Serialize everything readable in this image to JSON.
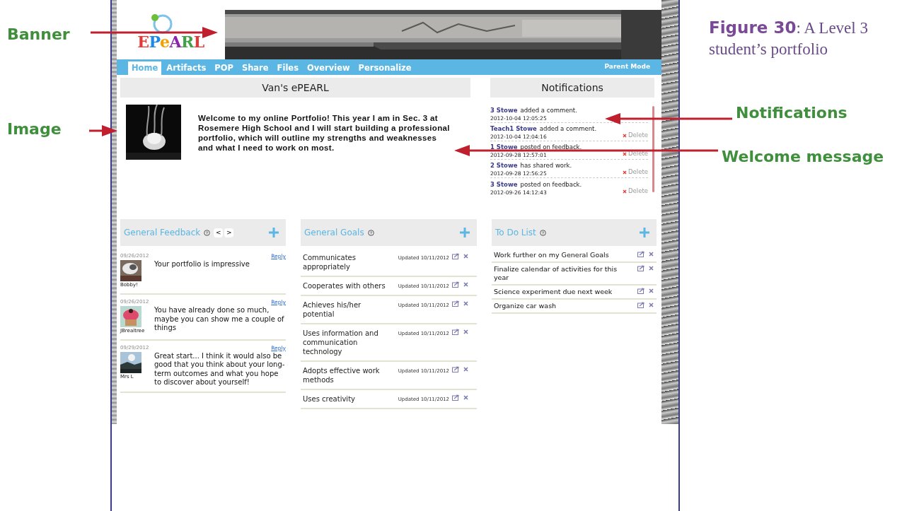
{
  "annotations": [
    {
      "label": "Banner"
    },
    {
      "label": "Image"
    },
    {
      "label": "Notifications"
    },
    {
      "label": "Welcome message"
    }
  ],
  "caption": {
    "figure": "Figure 30",
    "text": ": A Level 3 student’s portfolio"
  },
  "logo": {
    "text": "EPeARL"
  },
  "nav": {
    "tabs": [
      {
        "label": "Home",
        "selected": true
      },
      {
        "label": "Artifacts",
        "selected": false
      },
      {
        "label": "POP",
        "selected": false
      },
      {
        "label": "Share",
        "selected": false
      },
      {
        "label": "Files",
        "selected": false
      },
      {
        "label": "Overview",
        "selected": false
      },
      {
        "label": "Personalize",
        "selected": false
      }
    ],
    "parent_mode": "Parent Mode"
  },
  "welcome": {
    "title": "Van's ePEARL",
    "message": "Welcome to my online Portfolio! This year I am in Sec. 3 at Rosemere High School and I will start building a professional portfolio, which will outline my strengths and weaknesses and what I need to work on most."
  },
  "notifications": {
    "title": "Notifications",
    "items": [
      {
        "user": "3 Stowe",
        "action": "added a comment.",
        "time": "2012-10-04 12:05:25"
      },
      {
        "user": "Teach1 Stowe",
        "action": "added a comment.",
        "time": "2012-10-04 12:04:16",
        "delete": "Delete"
      },
      {
        "user": "1 Stowe",
        "action": "posted on feedback.",
        "time": "2012-09-28 12:57:01",
        "delete": "Delete"
      },
      {
        "user": "2 Stowe",
        "action": "has shared work.",
        "time": "2012-09-28 12:56:25",
        "delete": "Delete"
      },
      {
        "user": "3 Stowe",
        "action": "posted on feedback.",
        "time": "2012-09-26 14:12:43",
        "delete": "Delete"
      }
    ]
  },
  "feedback": {
    "title": "General Feedback",
    "prev": "<",
    "next": ">",
    "items": [
      {
        "date": "09/26/2012",
        "reply": "Reply",
        "author": "Bobby!",
        "text": "Your portfolio is impressive"
      },
      {
        "date": "09/26/2012",
        "reply": "Reply",
        "author": "JBrealtree",
        "text": "You have already done so much, maybe you can show me a couple of things"
      },
      {
        "date": "09/29/2012",
        "reply": "Reply",
        "author": "Mrs L",
        "text": "Great start... I think it would also be good that you think about your long-term outcomes and what you hope to discover about yourself!"
      }
    ]
  },
  "goals": {
    "title": "General Goals",
    "items": [
      {
        "name": "Communicates appropriately",
        "updated": "Updated 10/11/2012"
      },
      {
        "name": "Cooperates with others",
        "updated": "Updated 10/11/2012"
      },
      {
        "name": "Achieves his/her potential",
        "updated": "Updated 10/11/2012"
      },
      {
        "name": "Uses information and communication technology",
        "updated": "Updated 10/11/2012"
      },
      {
        "name": "Adopts effective work methods",
        "updated": "Updated 10/11/2012"
      },
      {
        "name": "Uses creativity",
        "updated": "Updated 10/11/2012"
      }
    ]
  },
  "todo": {
    "title": "To Do List",
    "items": [
      {
        "text": "Work further on my General Goals"
      },
      {
        "text": "Finalize calendar of activities for this year"
      },
      {
        "text": "Science experiment due next week"
      },
      {
        "text": "Organize car wash"
      }
    ]
  }
}
